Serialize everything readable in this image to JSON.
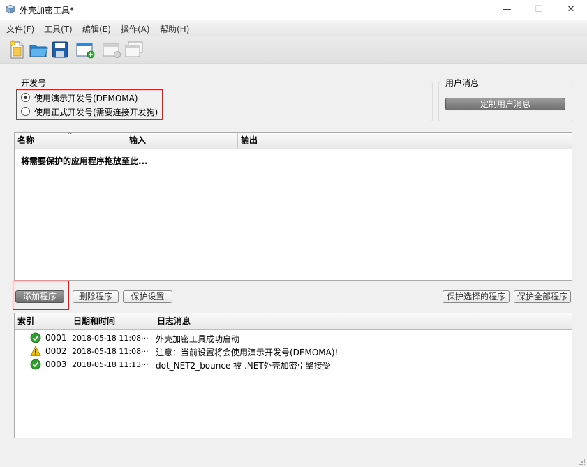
{
  "window": {
    "title": "外壳加密工具*",
    "controls": {
      "minimize": "—",
      "maximize": "☐",
      "close": "✕"
    }
  },
  "menu": [
    {
      "label": "文件(F)"
    },
    {
      "label": "工具(T)"
    },
    {
      "label": "编辑(E)"
    },
    {
      "label": "操作(A)"
    },
    {
      "label": "帮助(H)"
    }
  ],
  "toolbar": {
    "icons": [
      "new-file-icon",
      "open-folder-icon",
      "save-icon",
      "add-window-icon",
      "window-disabled-icon",
      "window-stack-disabled-icon"
    ]
  },
  "developer_group": {
    "label": "开发号",
    "options": [
      {
        "label": "使用演示开发号(DEMOMA)",
        "checked": true
      },
      {
        "label": "使用正式开发号(需要连接开发狗)",
        "checked": false
      }
    ]
  },
  "user_message_group": {
    "label": "用户消息",
    "button": "定制用户消息"
  },
  "program_list": {
    "columns": [
      "名称",
      "输入",
      "输出"
    ],
    "drop_hint": "将需要保护的应用程序拖放至此..."
  },
  "program_buttons": {
    "add": "添加程序",
    "delete": "删除程序",
    "settings": "保护设置",
    "protect_selected": "保护选择的程序",
    "protect_all": "保护全部程序"
  },
  "log": {
    "columns": [
      "索引",
      "日期和时间",
      "日志消息"
    ],
    "rows": [
      {
        "status": "success",
        "index": "0001",
        "time": "2018-05-18 11:08···",
        "message": "外壳加密工具成功启动"
      },
      {
        "status": "warning",
        "index": "0002",
        "time": "2018-05-18 11:08···",
        "message": "注意：当前设置将会使用演示开发号(DEMOMA)!"
      },
      {
        "status": "success",
        "index": "0003",
        "time": "2018-05-18 11:13···",
        "message": "dot_NET2_bounce 被 .NET外壳加密引擎接受"
      }
    ]
  },
  "colors": {
    "highlight_box": "#d42020",
    "success": "#2e9e2e",
    "warning": "#f2c200"
  }
}
